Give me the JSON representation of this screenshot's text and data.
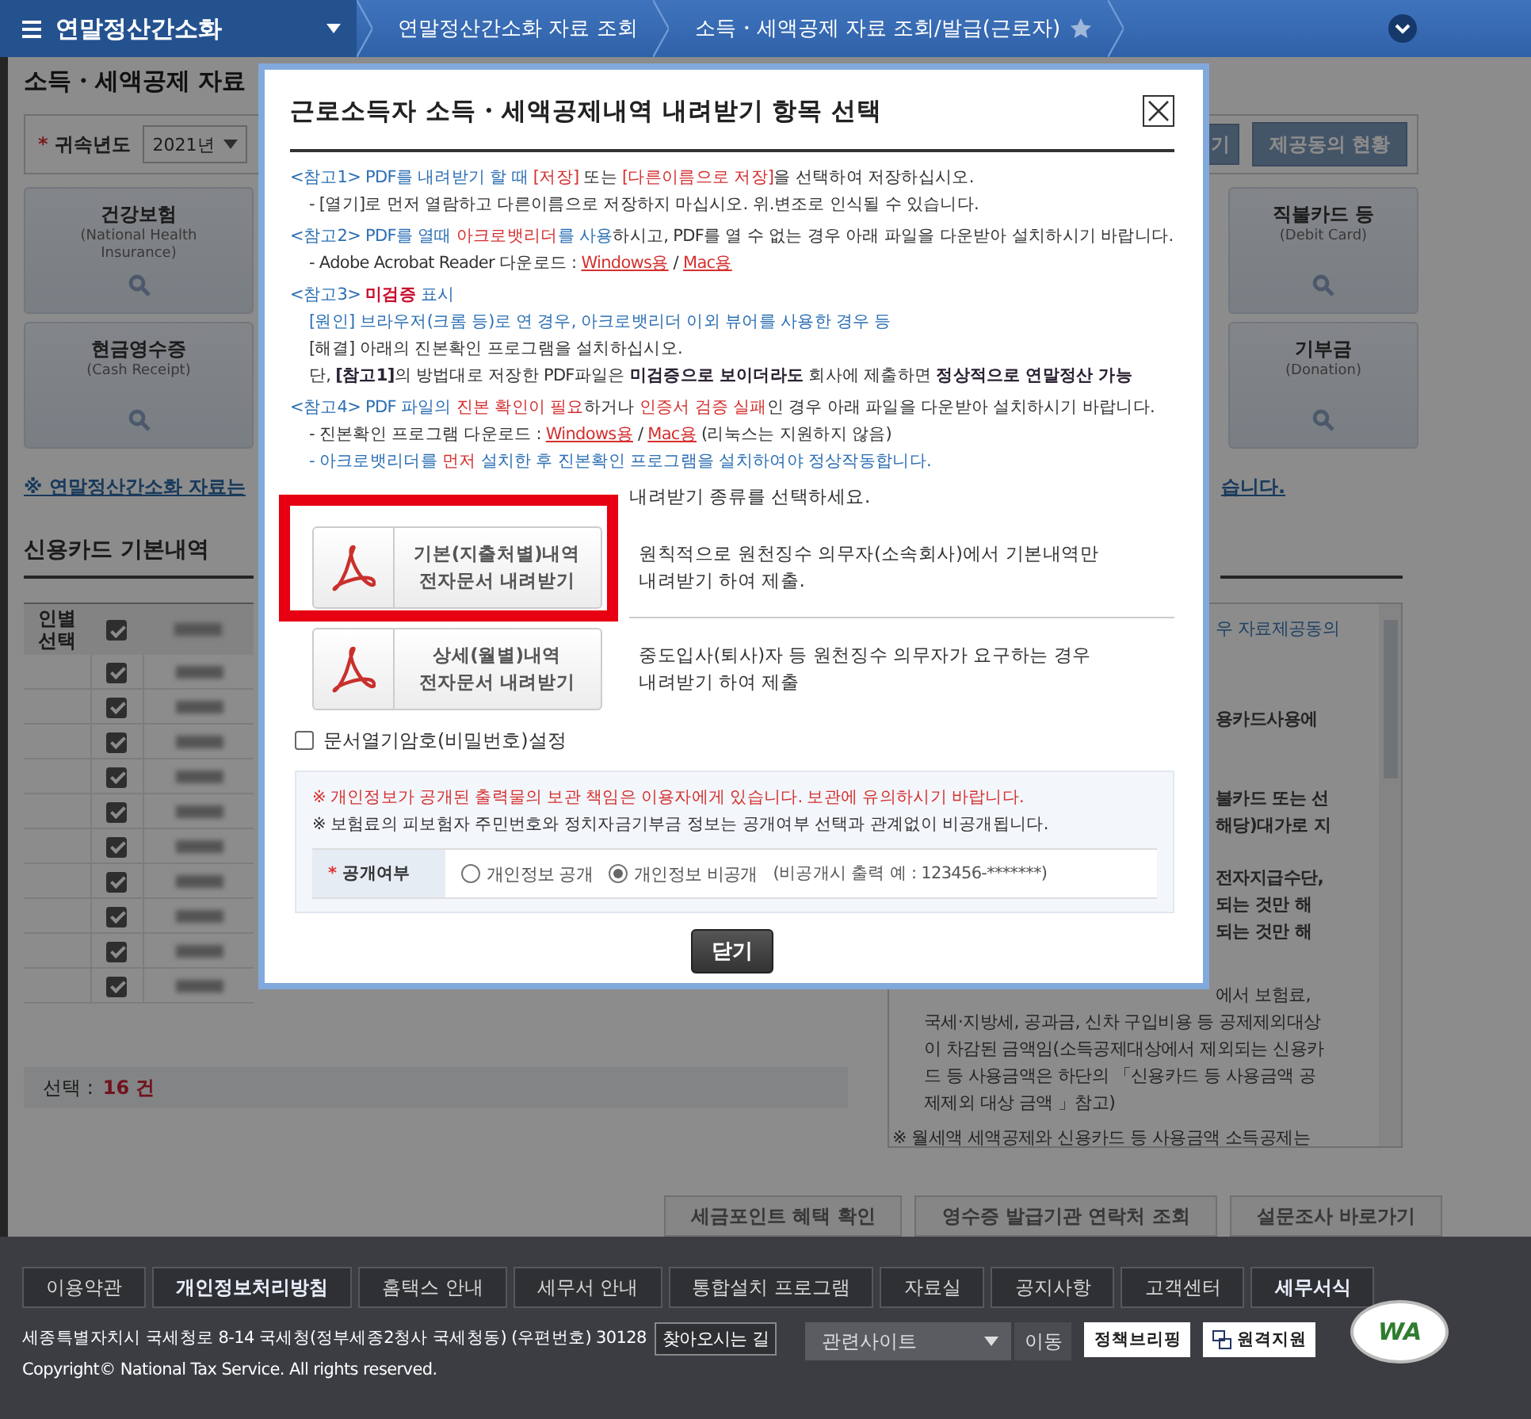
{
  "top_nav": {
    "menu_title": "연말정산간소화",
    "breadcrumbs": [
      "연말정산간소화 자료 조회",
      "소득・세액공제 자료 조회/발급(근로자)"
    ],
    "favorite": false
  },
  "page": {
    "title": "소득・세액공제 자료",
    "search": {
      "label_mark": "*",
      "label": "귀속년도",
      "year": "2021년"
    },
    "top_buttons": [
      "기",
      "제공동의 현황"
    ],
    "category_rows": [
      [
        {
          "name": "건강보험",
          "english": "(National Health Insurance)"
        },
        {
          "name": "직불카드 등",
          "english": "(Debit Card)"
        }
      ],
      [
        {
          "name": "현금영수증",
          "english": "(Cash Receipt)"
        },
        {
          "name": "기부금",
          "english": "(Donation)"
        }
      ]
    ],
    "notice_link": {
      "text": "※ 연말정산간소화 자료는",
      "tail": "습니다."
    },
    "card_section": {
      "title": "신용카드 기본내역",
      "header": "인별 선택",
      "header_checked": true,
      "rows": [
        {
          "checked": true
        },
        {
          "checked": true
        },
        {
          "checked": true
        },
        {
          "checked": true
        },
        {
          "checked": true
        },
        {
          "checked": true
        },
        {
          "checked": true
        },
        {
          "checked": true
        },
        {
          "checked": true
        },
        {
          "checked": true
        }
      ],
      "count_label": "선택 :",
      "count": "16 건",
      "info_paragraphs": [
        {
          "lines": [
            {
              "text": "우 자료제공동의",
              "kind": "link"
            }
          ]
        },
        {
          "lines": [
            {
              "text": "용카드사용에",
              "kind": "strong"
            }
          ]
        },
        {
          "lines": [
            {
              "text": "불카드 또는 선",
              "kind": "strong"
            },
            {
              "text": "해당)대가로 지",
              "kind": "strong"
            }
          ]
        },
        {
          "lines": [
            {
              "text": "전자지급수단,",
              "kind": "strong"
            },
            {
              "text": "되는 것만 해",
              "kind": "strong"
            },
            {
              "text": "되는 것만 해",
              "kind": "strong"
            }
          ]
        },
        {
          "lines": [
            {
              "text": "에서 보험료,",
              "kind": "fragment"
            },
            {
              "text": "국세·지방세, 공과금, 신차 구입비용 등 공제제외대상",
              "kind": "full"
            },
            {
              "text": "이 차감된 금액임(소득공제대상에서 제외되는 신용카",
              "kind": "full"
            },
            {
              "text": "드 등 사용금액은 하단의 「신용카드 등 사용금액 공",
              "kind": "full"
            },
            {
              "text": "제제외 대상 금액 」참고)",
              "kind": "full"
            }
          ]
        },
        {
          "lines": [
            {
              "text": "※ 월세액 세액공제와 신용카드 등 사용금액 소득공제는",
              "kind": "note"
            }
          ]
        }
      ]
    },
    "bottom_buttons": [
      "세금포인트 혜택 확인",
      "영수증 발급기관 연락처 조회",
      "설문조사 바로가기"
    ]
  },
  "modal": {
    "title": "근로소득자 소득・세액공제내역 내려받기 항목 선택",
    "notes": [
      {
        "segments": [
          {
            "text": "<참고1> PDF를 내려받기 할 때 ",
            "kind": "blue"
          },
          {
            "text": "[저장]",
            "kind": "red"
          },
          {
            "text": " 또는 ",
            "kind": "plain"
          },
          {
            "text": "[다른이름으로 저장]",
            "kind": "red"
          },
          {
            "text": "을 선택하여 저장하십시오.",
            "kind": "plain"
          }
        ],
        "children": [
          {
            "segments": [
              {
                "text": "- [열기]로 먼저 열람하고 다른이름으로 저장하지 마십시오. 위.변조로 인식될 수 있습니다.",
                "kind": "plain"
              }
            ]
          }
        ]
      },
      {
        "segments": [
          {
            "text": "<참고2> PDF를 열때 ",
            "kind": "blue"
          },
          {
            "text": "아크로뱃리더",
            "kind": "red"
          },
          {
            "text": "를 사용",
            "kind": "blue"
          },
          {
            "text": "하시고, PDF를 열 수 없는 경우 아래 파일을 다운받아 설치하시기 바랍니다.",
            "kind": "plain"
          }
        ],
        "children": [
          {
            "segments": [
              {
                "text": "- Adobe Acrobat Reader 다운로드 : ",
                "kind": "plain"
              },
              {
                "text": "Windows용",
                "kind": "link"
              },
              {
                "text": " / ",
                "kind": "plain"
              },
              {
                "text": "Mac용",
                "kind": "link"
              }
            ]
          }
        ]
      },
      {
        "segments": [
          {
            "text": "<참고3> ",
            "kind": "blue"
          },
          {
            "text": "미검증",
            "kind": "alert"
          },
          {
            "text": " 표시",
            "kind": "blue"
          }
        ],
        "children": [
          {
            "segments": [
              {
                "text": "[원인] 브라우저(크롬 등)로 연 경우, 아크로뱃리더 이외 뷰어를 사용한 경우 등",
                "kind": "blue"
              }
            ]
          },
          {
            "segments": [
              {
                "text": "[해결] 아래의 진본확인 프로그램을 설치하십시오.",
                "kind": "plain"
              }
            ]
          },
          {
            "segments": [
              {
                "text": "단, ",
                "kind": "plain"
              },
              {
                "text": "[참고1]",
                "kind": "strong"
              },
              {
                "text": "의 방법대로 저장한 PDF파일은 ",
                "kind": "plain"
              },
              {
                "text": "미검증으로 보이더라도",
                "kind": "strong"
              },
              {
                "text": " 회사에 제출하면 ",
                "kind": "plain"
              },
              {
                "text": "정상적으로 연말정산 가능",
                "kind": "strong"
              }
            ]
          }
        ]
      },
      {
        "segments": [
          {
            "text": "<참고4> PDF 파일의 ",
            "kind": "blue"
          },
          {
            "text": "진본 확인이 필요",
            "kind": "red"
          },
          {
            "text": "하거나 ",
            "kind": "plain"
          },
          {
            "text": "인증서 검증 실패",
            "kind": "red"
          },
          {
            "text": "인 경우 아래 파일을 다운받아 설치하시기 바랍니다.",
            "kind": "plain"
          }
        ],
        "children": [
          {
            "segments": [
              {
                "text": "- 진본확인 프로그램 다운로드 : ",
                "kind": "plain"
              },
              {
                "text": "Windows용",
                "kind": "link"
              },
              {
                "text": " / ",
                "kind": "plain"
              },
              {
                "text": "Mac용",
                "kind": "link"
              },
              {
                "text": " (리눅스는 지원하지 않음)",
                "kind": "plain"
              }
            ]
          },
          {
            "segments": [
              {
                "text": "- 아크로뱃리더를 ",
                "kind": "blue"
              },
              {
                "text": "먼저",
                "kind": "red"
              },
              {
                "text": " 설치한 후 진본확인 프로그램을 설치하여야 정상작동합니다.",
                "kind": "blue"
              }
            ]
          }
        ]
      }
    ],
    "prompt": "내려받기 종류를 선택하세요.",
    "options": [
      {
        "label_lines": [
          "기본(지출처별)내역",
          "전자문서 내려받기"
        ],
        "description_lines": [
          "원칙적으로 원천징수 의무자(소속회사)에서 기본내역만",
          "내려받기 하여 제출."
        ],
        "highlighted": true
      },
      {
        "label_lines": [
          "상세(월별)내역",
          "전자문서 내려받기"
        ],
        "description_lines": [
          "중도입사(퇴사)자 등 원천징수 의무자가 요구하는 경우",
          "내려받기 하여 제출"
        ],
        "highlighted": false
      }
    ],
    "password_option": {
      "label": "문서열기암호(비밀번호)설정",
      "checked": false
    },
    "privacy": {
      "notices": [
        {
          "text": "※ 개인정보가 공개된 출력물의 보관 책임은 이용자에게 있습니다. 보관에 유의하시기 바랍니다.",
          "kind": "warning"
        },
        {
          "text": "※ 보험료의 피보험자 주민번호와 정치자금기부금 정보는 공개여부 선택과 관계없이 비공개됩니다.",
          "kind": "info"
        }
      ],
      "label_mark": "*",
      "label": "공개여부",
      "choices": [
        {
          "label": "개인정보 공개",
          "selected": false
        },
        {
          "label": "개인정보 비공개",
          "selected": true
        }
      ],
      "hint": "(비공개시 출력 예 : 123456-*******)"
    },
    "close_button": "닫기"
  },
  "footer": {
    "links": [
      {
        "label": "이용약관",
        "emphasis": false
      },
      {
        "label": "개인정보처리방침",
        "emphasis": true
      },
      {
        "label": "홈택스 안내",
        "emphasis": false
      },
      {
        "label": "세무서 안내",
        "emphasis": false
      },
      {
        "label": "통합설치 프로그램",
        "emphasis": false
      },
      {
        "label": "자료실",
        "emphasis": false
      },
      {
        "label": "공지사항",
        "emphasis": false
      },
      {
        "label": "고객센터",
        "emphasis": false
      },
      {
        "label": "세무서식",
        "emphasis": true
      }
    ],
    "address": "세종특별자치시 국세청로 8-14 국세청(정부세종2청사 국세청동) (우편번호) 30128",
    "directions_button": "찾아오시는 길",
    "copyright": "Copyright© National Tax Service. All rights reserved.",
    "related_select": "관련사이트",
    "go_button": "이동",
    "briefing_badge": "정책브리핑",
    "remote_button": "원격지원",
    "wa_mark": "WA"
  }
}
